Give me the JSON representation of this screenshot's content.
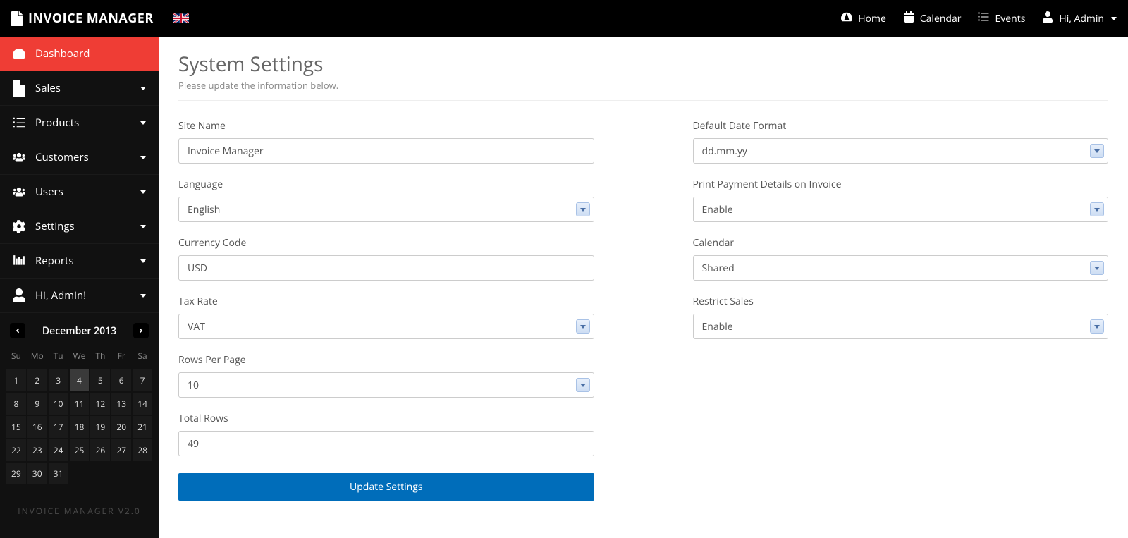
{
  "brand": "INVOICE MANAGER",
  "topnav": {
    "home": "Home",
    "calendar": "Calendar",
    "events": "Events",
    "user": "Hi, Admin"
  },
  "sidebar": {
    "items": [
      {
        "label": "Dashboard",
        "active": true,
        "caret": false
      },
      {
        "label": "Sales",
        "active": false,
        "caret": true
      },
      {
        "label": "Products",
        "active": false,
        "caret": true
      },
      {
        "label": "Customers",
        "active": false,
        "caret": true
      },
      {
        "label": "Users",
        "active": false,
        "caret": true
      },
      {
        "label": "Settings",
        "active": false,
        "caret": true
      },
      {
        "label": "Reports",
        "active": false,
        "caret": true
      },
      {
        "label": "Hi, Admin!",
        "active": false,
        "caret": true
      }
    ]
  },
  "calendar": {
    "title": "December 2013",
    "dow": [
      "Su",
      "Mo",
      "Tu",
      "We",
      "Th",
      "Fr",
      "Sa"
    ],
    "startOffset": 0,
    "days": 31,
    "today": 4
  },
  "footer": "INVOICE MANAGER V2.0",
  "page": {
    "title": "System Settings",
    "subtitle": "Please update the information below."
  },
  "form": {
    "left": [
      {
        "label": "Site Name",
        "type": "text",
        "value": "Invoice Manager"
      },
      {
        "label": "Language",
        "type": "select",
        "value": "English"
      },
      {
        "label": "Currency Code",
        "type": "text",
        "value": "USD"
      },
      {
        "label": "Tax Rate",
        "type": "select",
        "value": "VAT"
      },
      {
        "label": "Rows Per Page",
        "type": "select",
        "value": "10"
      },
      {
        "label": "Total Rows",
        "type": "text",
        "value": "49"
      }
    ],
    "right": [
      {
        "label": "Default Date Format",
        "type": "select",
        "value": "dd.mm.yy"
      },
      {
        "label": "Print Payment Details on Invoice",
        "type": "select",
        "value": "Enable"
      },
      {
        "label": "Calendar",
        "type": "select",
        "value": "Shared"
      },
      {
        "label": "Restrict Sales",
        "type": "select",
        "value": "Enable"
      }
    ],
    "submit": "Update Settings"
  }
}
